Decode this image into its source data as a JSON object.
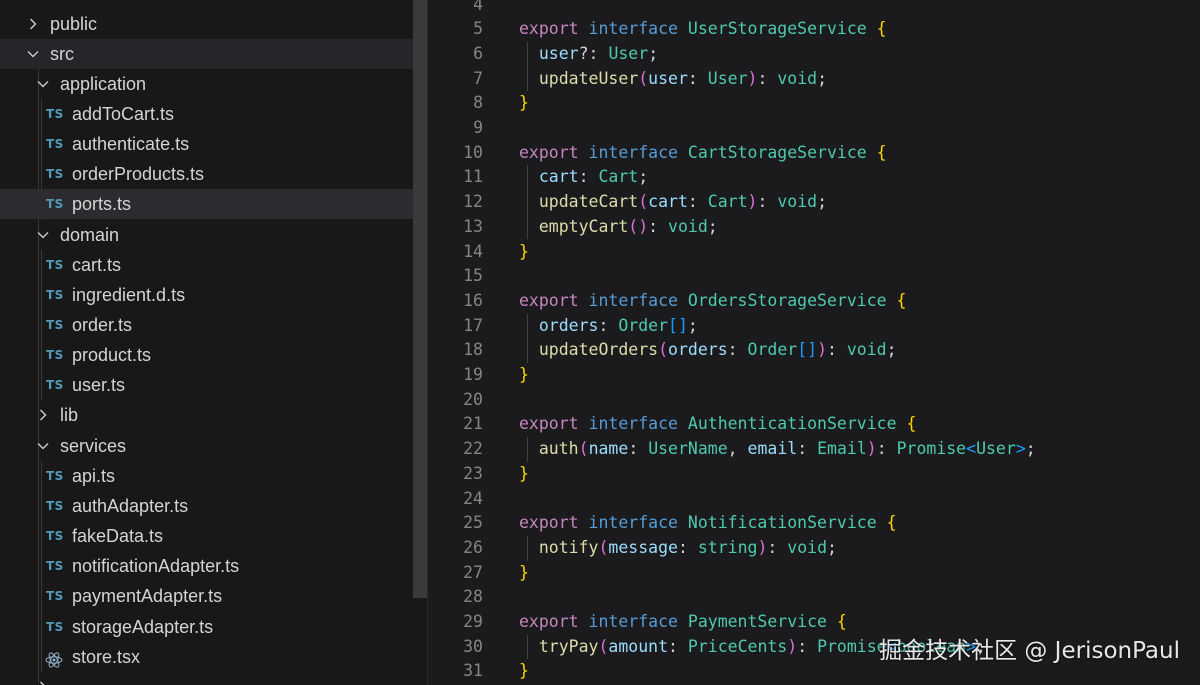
{
  "explorer": {
    "rows": [
      {
        "label": "public",
        "kind": "folder",
        "expanded": false,
        "depth": 0
      },
      {
        "label": "src",
        "kind": "folder",
        "expanded": true,
        "depth": 0
      },
      {
        "label": "application",
        "kind": "folder",
        "expanded": true,
        "depth": 1
      },
      {
        "label": "addToCart.ts",
        "kind": "ts",
        "depth": 2
      },
      {
        "label": "authenticate.ts",
        "kind": "ts",
        "depth": 2
      },
      {
        "label": "orderProducts.ts",
        "kind": "ts",
        "depth": 2
      },
      {
        "label": "ports.ts",
        "kind": "ts",
        "depth": 2,
        "selected": true
      },
      {
        "label": "domain",
        "kind": "folder",
        "expanded": true,
        "depth": 1
      },
      {
        "label": "cart.ts",
        "kind": "ts",
        "depth": 2
      },
      {
        "label": "ingredient.d.ts",
        "kind": "ts",
        "depth": 2
      },
      {
        "label": "order.ts",
        "kind": "ts",
        "depth": 2
      },
      {
        "label": "product.ts",
        "kind": "ts",
        "depth": 2
      },
      {
        "label": "user.ts",
        "kind": "ts",
        "depth": 2
      },
      {
        "label": "lib",
        "kind": "folder",
        "expanded": false,
        "depth": 1
      },
      {
        "label": "services",
        "kind": "folder",
        "expanded": true,
        "depth": 1
      },
      {
        "label": "api.ts",
        "kind": "ts",
        "depth": 2
      },
      {
        "label": "authAdapter.ts",
        "kind": "ts",
        "depth": 2
      },
      {
        "label": "fakeData.ts",
        "kind": "ts",
        "depth": 2
      },
      {
        "label": "notificationAdapter.ts",
        "kind": "ts",
        "depth": 2
      },
      {
        "label": "paymentAdapter.ts",
        "kind": "ts",
        "depth": 2
      },
      {
        "label": "storageAdapter.ts",
        "kind": "ts",
        "depth": 2
      },
      {
        "label": "store.tsx",
        "kind": "react",
        "depth": 2
      }
    ],
    "ts_badge": "TS"
  },
  "editor": {
    "lines": [
      {
        "n": "4",
        "tokens": []
      },
      {
        "n": "5",
        "tokens": [
          [
            "kw",
            "export"
          ],
          [
            "p",
            " "
          ],
          [
            "kw2",
            "interface"
          ],
          [
            "p",
            " "
          ],
          [
            "type",
            "UserStorageService"
          ],
          [
            "p",
            " "
          ],
          [
            "brace",
            "{"
          ]
        ]
      },
      {
        "n": "6",
        "tokens": [
          [
            "p",
            "  "
          ],
          [
            "prop",
            "user"
          ],
          [
            "p",
            "?: "
          ],
          [
            "type",
            "User"
          ],
          [
            "p",
            ";"
          ]
        ]
      },
      {
        "n": "7",
        "tokens": [
          [
            "p",
            "  "
          ],
          [
            "fn",
            "updateUser"
          ],
          [
            "paren",
            "("
          ],
          [
            "prop",
            "user"
          ],
          [
            "p",
            ": "
          ],
          [
            "type",
            "User"
          ],
          [
            "paren",
            ")"
          ],
          [
            "p",
            ": "
          ],
          [
            "type",
            "void"
          ],
          [
            "p",
            ";"
          ]
        ]
      },
      {
        "n": "8",
        "tokens": [
          [
            "brace",
            "}"
          ]
        ]
      },
      {
        "n": "9",
        "tokens": []
      },
      {
        "n": "10",
        "tokens": [
          [
            "kw",
            "export"
          ],
          [
            "p",
            " "
          ],
          [
            "kw2",
            "interface"
          ],
          [
            "p",
            " "
          ],
          [
            "type",
            "CartStorageService"
          ],
          [
            "p",
            " "
          ],
          [
            "brace",
            "{"
          ]
        ]
      },
      {
        "n": "11",
        "tokens": [
          [
            "p",
            "  "
          ],
          [
            "prop",
            "cart"
          ],
          [
            "p",
            ": "
          ],
          [
            "type",
            "Cart"
          ],
          [
            "p",
            ";"
          ]
        ]
      },
      {
        "n": "12",
        "tokens": [
          [
            "p",
            "  "
          ],
          [
            "fn",
            "updateCart"
          ],
          [
            "paren",
            "("
          ],
          [
            "prop",
            "cart"
          ],
          [
            "p",
            ": "
          ],
          [
            "type",
            "Cart"
          ],
          [
            "paren",
            ")"
          ],
          [
            "p",
            ": "
          ],
          [
            "type",
            "void"
          ],
          [
            "p",
            ";"
          ]
        ]
      },
      {
        "n": "13",
        "tokens": [
          [
            "p",
            "  "
          ],
          [
            "fn",
            "emptyCart"
          ],
          [
            "paren",
            "()"
          ],
          [
            "p",
            ": "
          ],
          [
            "type",
            "void"
          ],
          [
            "p",
            ";"
          ]
        ]
      },
      {
        "n": "14",
        "tokens": [
          [
            "brace",
            "}"
          ]
        ]
      },
      {
        "n": "15",
        "tokens": []
      },
      {
        "n": "16",
        "tokens": [
          [
            "kw",
            "export"
          ],
          [
            "p",
            " "
          ],
          [
            "kw2",
            "interface"
          ],
          [
            "p",
            " "
          ],
          [
            "type",
            "OrdersStorageService"
          ],
          [
            "p",
            " "
          ],
          [
            "brace",
            "{"
          ]
        ]
      },
      {
        "n": "17",
        "tokens": [
          [
            "p",
            "  "
          ],
          [
            "prop",
            "orders"
          ],
          [
            "p",
            ": "
          ],
          [
            "type",
            "Order"
          ],
          [
            "bracket",
            "[]"
          ],
          [
            "p",
            ";"
          ]
        ]
      },
      {
        "n": "18",
        "tokens": [
          [
            "p",
            "  "
          ],
          [
            "fn",
            "updateOrders"
          ],
          [
            "paren",
            "("
          ],
          [
            "prop",
            "orders"
          ],
          [
            "p",
            ": "
          ],
          [
            "type",
            "Order"
          ],
          [
            "bracket",
            "[]"
          ],
          [
            "paren",
            ")"
          ],
          [
            "p",
            ": "
          ],
          [
            "type",
            "void"
          ],
          [
            "p",
            ";"
          ]
        ]
      },
      {
        "n": "19",
        "tokens": [
          [
            "brace",
            "}"
          ]
        ]
      },
      {
        "n": "20",
        "tokens": []
      },
      {
        "n": "21",
        "tokens": [
          [
            "kw",
            "export"
          ],
          [
            "p",
            " "
          ],
          [
            "kw2",
            "interface"
          ],
          [
            "p",
            " "
          ],
          [
            "type",
            "AuthenticationService"
          ],
          [
            "p",
            " "
          ],
          [
            "brace",
            "{"
          ]
        ]
      },
      {
        "n": "22",
        "tokens": [
          [
            "p",
            "  "
          ],
          [
            "fn",
            "auth"
          ],
          [
            "paren",
            "("
          ],
          [
            "prop",
            "name"
          ],
          [
            "p",
            ": "
          ],
          [
            "type",
            "UserName"
          ],
          [
            "p",
            ", "
          ],
          [
            "prop",
            "email"
          ],
          [
            "p",
            ": "
          ],
          [
            "type",
            "Email"
          ],
          [
            "paren",
            ")"
          ],
          [
            "p",
            ": "
          ],
          [
            "type",
            "Promise"
          ],
          [
            "bracket",
            "<"
          ],
          [
            "type",
            "User"
          ],
          [
            "bracket",
            ">"
          ],
          [
            "p",
            ";"
          ]
        ]
      },
      {
        "n": "23",
        "tokens": [
          [
            "brace",
            "}"
          ]
        ]
      },
      {
        "n": "24",
        "tokens": []
      },
      {
        "n": "25",
        "tokens": [
          [
            "kw",
            "export"
          ],
          [
            "p",
            " "
          ],
          [
            "kw2",
            "interface"
          ],
          [
            "p",
            " "
          ],
          [
            "type",
            "NotificationService"
          ],
          [
            "p",
            " "
          ],
          [
            "brace",
            "{"
          ]
        ]
      },
      {
        "n": "26",
        "tokens": [
          [
            "p",
            "  "
          ],
          [
            "fn",
            "notify"
          ],
          [
            "paren",
            "("
          ],
          [
            "prop",
            "message"
          ],
          [
            "p",
            ": "
          ],
          [
            "type",
            "string"
          ],
          [
            "paren",
            ")"
          ],
          [
            "p",
            ": "
          ],
          [
            "type",
            "void"
          ],
          [
            "p",
            ";"
          ]
        ]
      },
      {
        "n": "27",
        "tokens": [
          [
            "brace",
            "}"
          ]
        ]
      },
      {
        "n": "28",
        "tokens": []
      },
      {
        "n": "29",
        "tokens": [
          [
            "kw",
            "export"
          ],
          [
            "p",
            " "
          ],
          [
            "kw2",
            "interface"
          ],
          [
            "p",
            " "
          ],
          [
            "type",
            "PaymentService"
          ],
          [
            "p",
            " "
          ],
          [
            "brace",
            "{"
          ]
        ]
      },
      {
        "n": "30",
        "tokens": [
          [
            "p",
            "  "
          ],
          [
            "fn",
            "tryPay"
          ],
          [
            "paren",
            "("
          ],
          [
            "prop",
            "amount"
          ],
          [
            "p",
            ": "
          ],
          [
            "type",
            "PriceCents"
          ],
          [
            "paren",
            ")"
          ],
          [
            "p",
            ": "
          ],
          [
            "type",
            "Promise"
          ],
          [
            "bracket",
            "<"
          ],
          [
            "type",
            "boolean"
          ],
          [
            "bracket",
            ">"
          ],
          [
            "p",
            ";"
          ]
        ]
      },
      {
        "n": "31",
        "tokens": [
          [
            "brace",
            "}"
          ]
        ]
      }
    ]
  },
  "watermark": "掘金技术社区 @ JerisonPaul",
  "colors": {
    "background": "#1b1b1d",
    "sidebar": "#181818",
    "selected_row": "#2c2c30",
    "ts_icon": "#519aba",
    "keyword": "#c586c0",
    "keyword_interface": "#569cd6",
    "type": "#4ec9b0",
    "property": "#9cdcfe",
    "function": "#dcdcaa",
    "brace": "#ffd700"
  }
}
